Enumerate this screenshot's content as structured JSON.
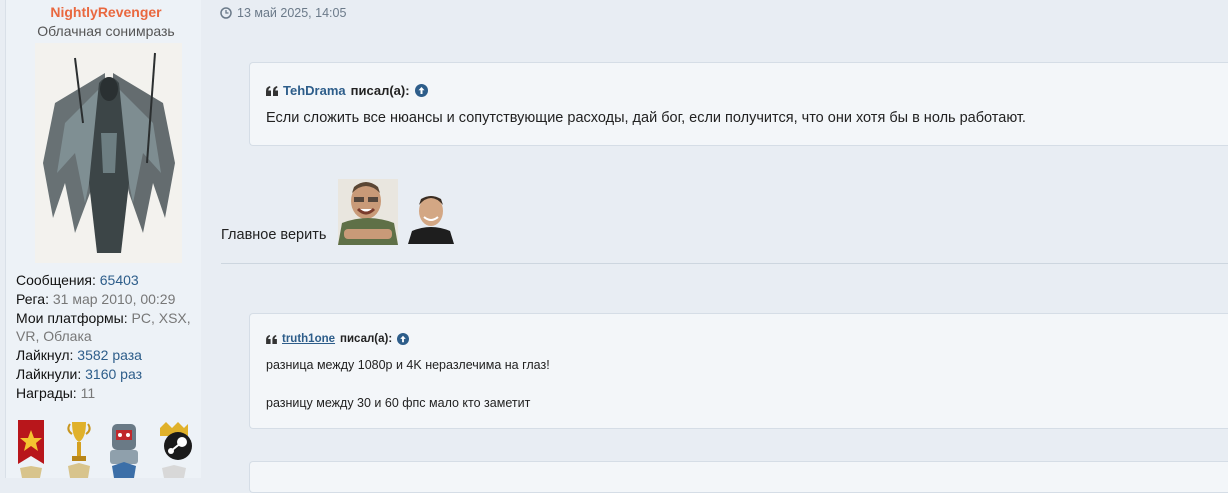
{
  "author": {
    "name": "NightlyRevenger",
    "title": "Облачная сонимразь",
    "stats": [
      {
        "label": "Сообщения:",
        "value": "65403",
        "style": "link"
      },
      {
        "label": "Рега:",
        "value": "31 мар 2010, 00:29",
        "style": "plain"
      },
      {
        "label": "Мои платформы:",
        "value": "PC, XSX,",
        "style": "plain"
      },
      {
        "label": "",
        "value": "VR, Облака",
        "style": "plain"
      },
      {
        "label": "Лайкнул:",
        "value": "3582 раза",
        "style": "link"
      },
      {
        "label": "Лайкнули:",
        "value": "3160 раз",
        "style": "link"
      },
      {
        "label": "Награды:",
        "value": "11",
        "style": "plain"
      }
    ],
    "awards": [
      "star-ribbon-award-icon",
      "trophy-award-icon",
      "robot-award-icon",
      "steam-crown-award-icon"
    ]
  },
  "post": {
    "date": "13 май 2025, 14:05",
    "quote1": {
      "author": "TehDrama",
      "said": "писал(а):",
      "text": "Если сложить все нюансы и сопутствующие расходы, дай бог, если получится, что они хотя бы в ноль работают."
    },
    "body_text": "Главное верить",
    "quote2": {
      "author": "truth1one",
      "said": "писал(а):",
      "line1": "разница между 1080p и 4K неразлечима на глаз!",
      "line2": "разницу между 30 и 60 фпс мало кто заметит"
    }
  },
  "colors": {
    "username": "#e9683f",
    "link": "#2d5d8a",
    "background": "#e8edf3",
    "quote_bg": "#f3f6f9"
  }
}
